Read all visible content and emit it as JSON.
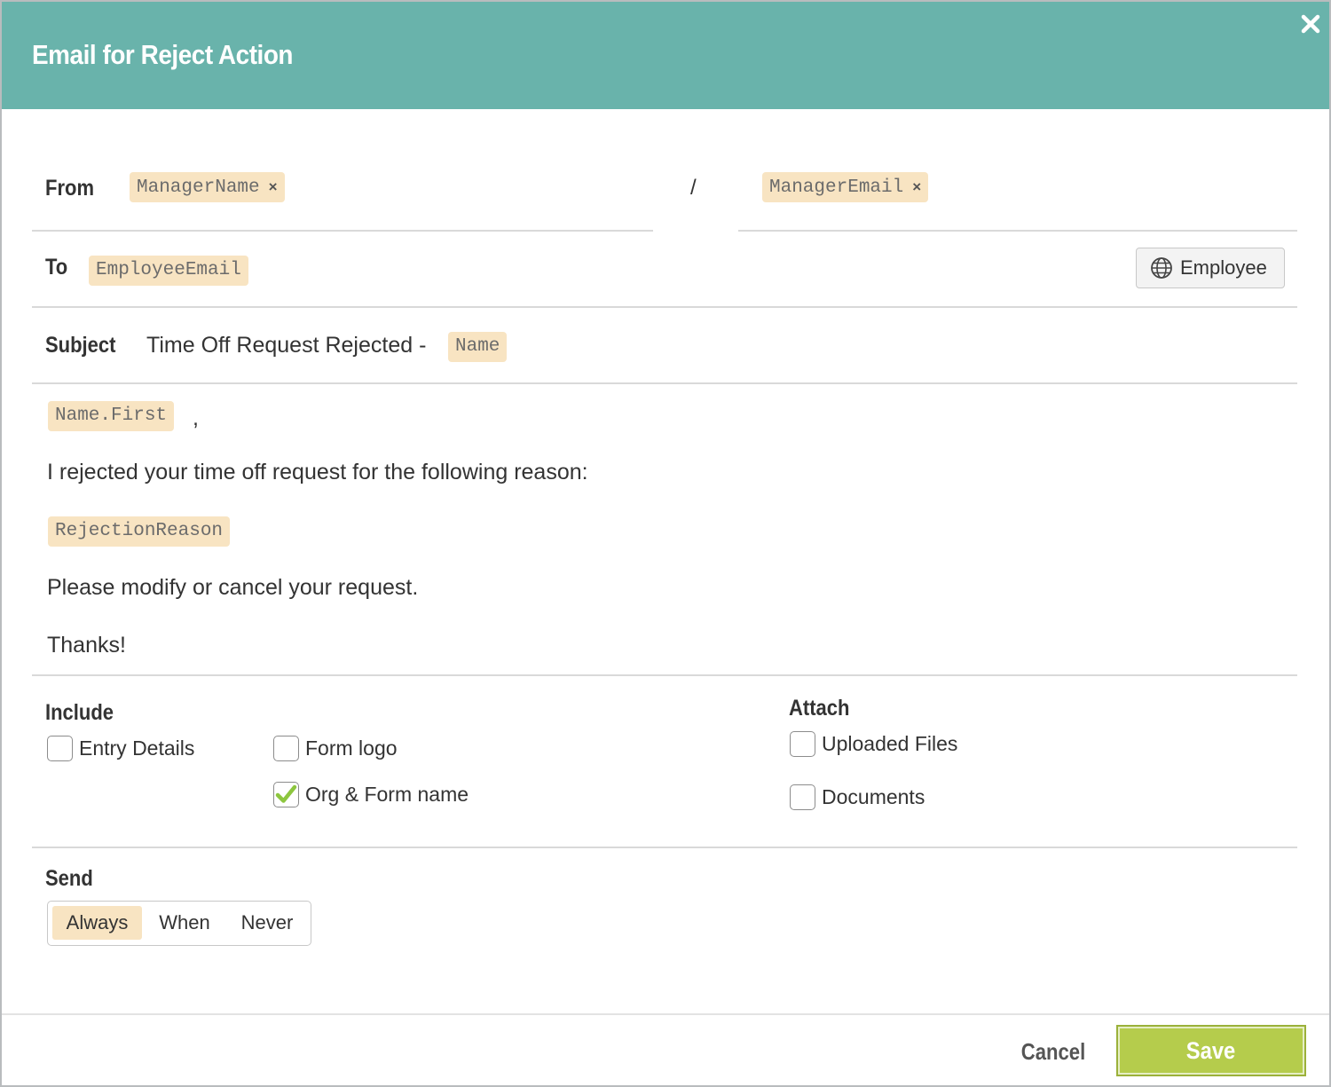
{
  "dialog": {
    "title": "Email for Reject Action"
  },
  "from": {
    "label": "From",
    "name_token": "ManagerName",
    "separator": "/",
    "email_token": "ManagerEmail",
    "remove_symbol": "×"
  },
  "to": {
    "label": "To",
    "token": "EmployeeEmail",
    "picker_button": "Employee",
    "picker_icon": "globe-icon"
  },
  "subject": {
    "label": "Subject",
    "text": "Time Off Request Rejected -",
    "token": "Name"
  },
  "body": {
    "greeting_token": "Name.First",
    "greeting_suffix": ",",
    "line1": "I rejected your time off request for the following reason:",
    "reason_token": "RejectionReason",
    "line2": "Please modify or cancel your request.",
    "line3": "Thanks!"
  },
  "include": {
    "label": "Include",
    "options": [
      {
        "label": "Entry Details",
        "checked": false
      },
      {
        "label": "Form logo",
        "checked": false
      },
      {
        "label": "Org & Form name",
        "checked": true
      }
    ]
  },
  "attach": {
    "label": "Attach",
    "options": [
      {
        "label": "Uploaded Files",
        "checked": false
      },
      {
        "label": "Documents",
        "checked": false
      }
    ]
  },
  "send": {
    "label": "Send",
    "options": [
      "Always",
      "When",
      "Never"
    ],
    "selected": "Always"
  },
  "footer": {
    "cancel_label": "Cancel",
    "save_label": "Save"
  },
  "colors": {
    "header": "#69b3ab",
    "token_bg": "#f8e4c2",
    "save": "#b5cc4c",
    "check": "#8dc63f"
  }
}
